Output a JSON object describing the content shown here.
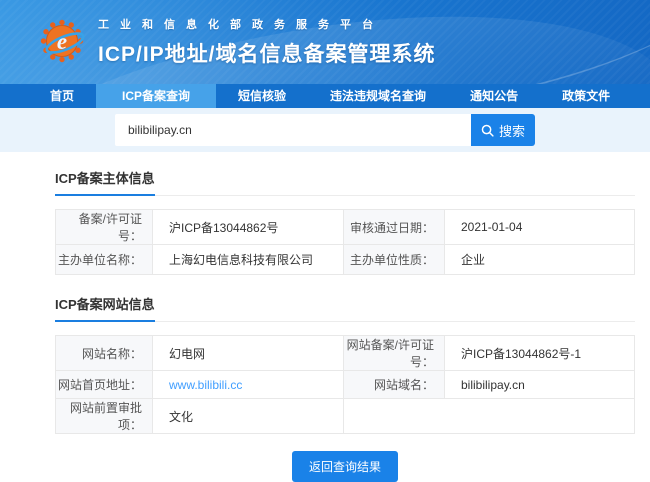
{
  "header": {
    "platform_title": "工业和信息化部政务服务平台",
    "system_title": "ICP/IP地址/域名信息备案管理系统"
  },
  "nav": {
    "active_index": 1,
    "items": [
      {
        "label": "首页"
      },
      {
        "label": "ICP备案查询"
      },
      {
        "label": "短信核验"
      },
      {
        "label": "违法违规域名查询"
      },
      {
        "label": "通知公告"
      },
      {
        "label": "政策文件"
      }
    ]
  },
  "search": {
    "value": "bilibilipay.cn",
    "button_label": "搜索",
    "icon": "magnifier"
  },
  "sections": {
    "subject": {
      "title": "ICP备案主体信息",
      "rows": [
        {
          "c0": {
            "label": "备案/许可证号：",
            "value": "沪ICP备13044862号"
          },
          "c1": {
            "label": "审核通过日期：",
            "value": "2021-01-04"
          }
        },
        {
          "c0": {
            "label": "主办单位名称：",
            "value": "上海幻电信息科技有限公司"
          },
          "c1": {
            "label": "主办单位性质：",
            "value": "企业"
          }
        }
      ]
    },
    "website": {
      "title": "ICP备案网站信息",
      "rows": [
        {
          "c0": {
            "label": "网站名称：",
            "value": "幻电网"
          },
          "c1": {
            "label": "网站备案/许可证号：",
            "value": "沪ICP备13044862号-1"
          }
        },
        {
          "c0": {
            "label": "网站首页地址：",
            "value": "www.bilibili.cc"
          },
          "c1": {
            "label": "网站域名：",
            "value": "bilibilipay.cn"
          }
        },
        {
          "c0": {
            "label": "网站前置审批项：",
            "value": "文化"
          }
        }
      ]
    }
  },
  "footer": {
    "back_button_label": "返回查询结果"
  },
  "colors": {
    "header_blue": "#1b7ad3",
    "nav_blue": "#1470cc",
    "nav_active_blue": "#46a2e9",
    "accent_blue": "#1a82e8",
    "search_area_bg": "#e9f3fc",
    "link_blue": "#409eff",
    "label_cell_bg": "#f7f8fa"
  }
}
